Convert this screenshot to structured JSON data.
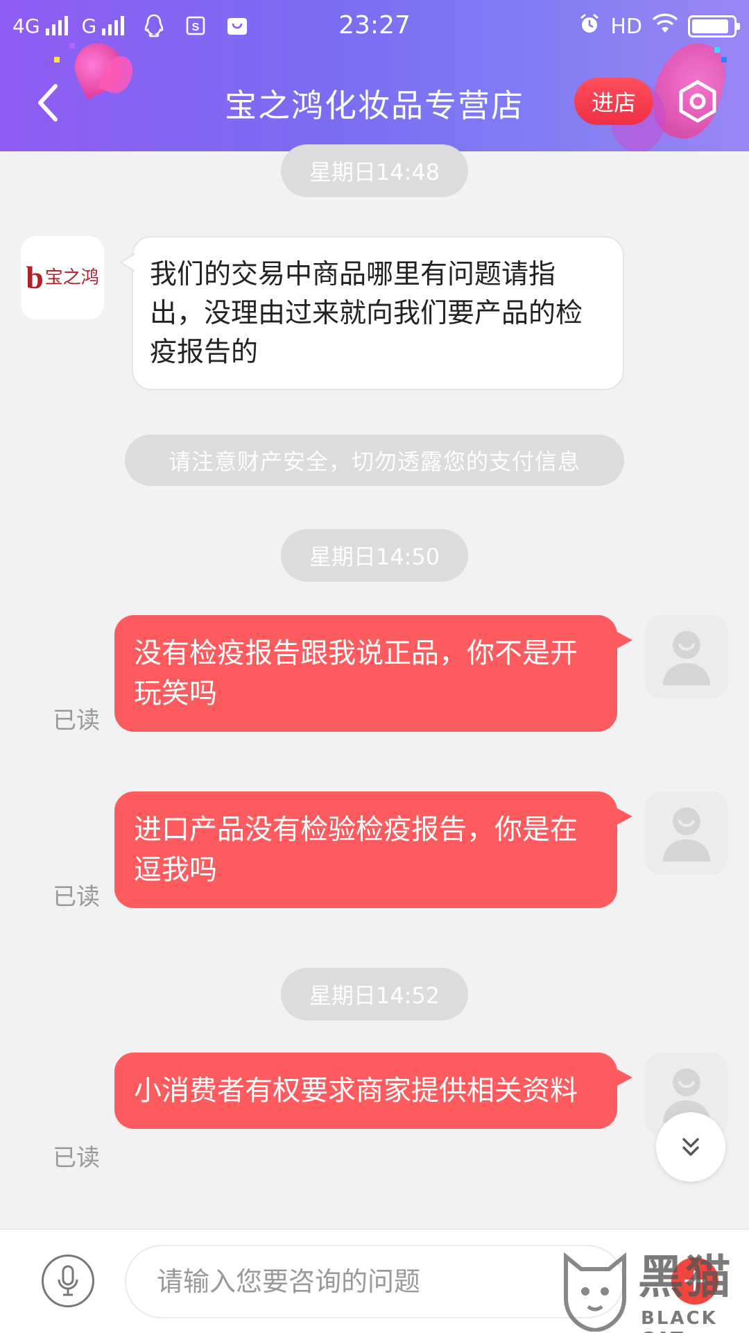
{
  "status_bar": {
    "network_left": "4G",
    "network_right": "G",
    "time": "23:27",
    "hd": "HD",
    "battery_level": 0.9
  },
  "header": {
    "back_icon": "chevron-left-icon",
    "title": "宝之鸿化妆品专营店",
    "enter_label": "进店",
    "settings_icon": "hexagon-settings-icon"
  },
  "shop": {
    "logo_text": "宝之鸿"
  },
  "messages": [
    {
      "type": "time",
      "text": "星期日14:48"
    },
    {
      "type": "incoming",
      "text": "我们的交易中商品哪里有问题请指出，没理由过来就向我们要产品的检疫报告的"
    },
    {
      "type": "notice",
      "text": "请注意财产安全，切勿透露您的支付信息"
    },
    {
      "type": "time",
      "text": "星期日14:50"
    },
    {
      "type": "outgoing",
      "text": "没有检疫报告跟我说正品，你不是开玩笑吗",
      "status": "已读"
    },
    {
      "type": "outgoing",
      "text": "进口产品没有检验检疫报告，你是在逗我吗",
      "status": "已读"
    },
    {
      "type": "time",
      "text": "星期日14:52"
    },
    {
      "type": "outgoing",
      "text": "小消费者有权要求商家提供相关资料",
      "status": "已读"
    }
  ],
  "input": {
    "placeholder": "请输入您要咨询的问题",
    "value": ""
  },
  "watermark": {
    "cn": "黑猫",
    "en": "BLACK CAT"
  },
  "colors": {
    "header_gradient_start": "#8f5cf3",
    "header_gradient_end": "#9a86f5",
    "enter_button": "#ef2f45",
    "outgoing_bubble": "#fe5b5f",
    "incoming_bubble": "#ffffff",
    "pill": "#dcdcdf",
    "background": "#f2f2f4"
  }
}
